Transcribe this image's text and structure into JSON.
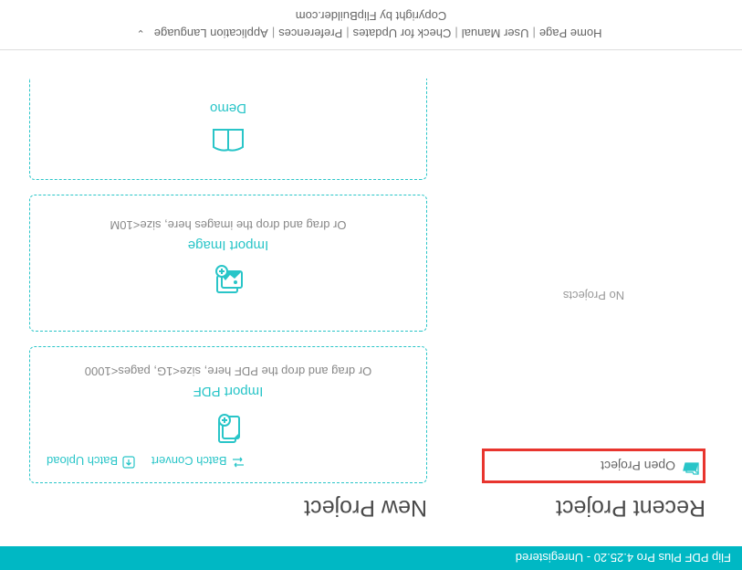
{
  "header": {
    "title": "Flip PDF Plus Pro 4.25.20 - Unregistered"
  },
  "recent": {
    "title": "Recent Project",
    "open_label": "Open Project",
    "empty": "No Projects"
  },
  "newproj": {
    "title": "New Project",
    "batch_convert": "Batch Convert",
    "batch_upload": "Batch Upload",
    "import_pdf": {
      "title": "Import PDF",
      "hint": "Or drag and drop the PDF here, size<1G, pages<1000"
    },
    "import_image": {
      "title": "Import Image",
      "hint": "Or drag and drop the images here, size<10M"
    },
    "demo": {
      "title": "Demo"
    }
  },
  "footer": {
    "links": {
      "home": "Home Page",
      "manual": "User Manual",
      "updates": "Check for Updates",
      "prefs": "Preferences",
      "lang": "Application Language"
    },
    "copyright": "Copyright by FlipBuilder.com"
  }
}
